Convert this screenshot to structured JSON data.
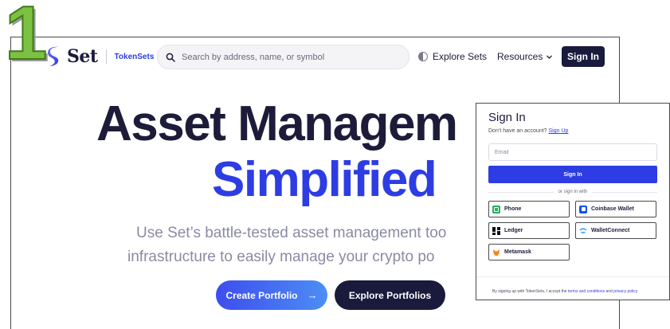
{
  "step_label": "1",
  "nav": {
    "logo_text": "Set",
    "logo_sub": "TokenSets",
    "search_placeholder": "Search by address, name, or symbol",
    "explore_label": "Explore Sets",
    "resources_label": "Resources",
    "signin_label": "Sign In"
  },
  "hero": {
    "line1": "Asset Managem",
    "line2": "Simplified",
    "sub1": "Use Set’s battle-tested asset management too",
    "sub2": "infrastructure to easily manage your crypto po",
    "create_label": "Create Portfolio",
    "create_arrow": "→",
    "explore_label": "Explore Portfolios"
  },
  "signin_popup": {
    "title": "Sign In",
    "question": "Don’t have an account?",
    "signup_link": "Sign Up",
    "email_placeholder": "Email",
    "signin_button": "Sign In",
    "divider_text": "or sign in with",
    "wallets": {
      "phone": "Phone",
      "coinbase": "Coinbase Wallet",
      "ledger": "Ledger",
      "walletconnect": "WalletConnect",
      "metamask": "Metamask"
    },
    "footer_prefix": "By signing up with TokenSets, I accept the",
    "footer_terms": "terms and conditions",
    "footer_and": "and",
    "footer_privacy": "privacy policy"
  },
  "colors": {
    "brand_navy": "#1a1a3d",
    "brand_blue": "#2d3de3",
    "step_green": "#7dc142"
  }
}
